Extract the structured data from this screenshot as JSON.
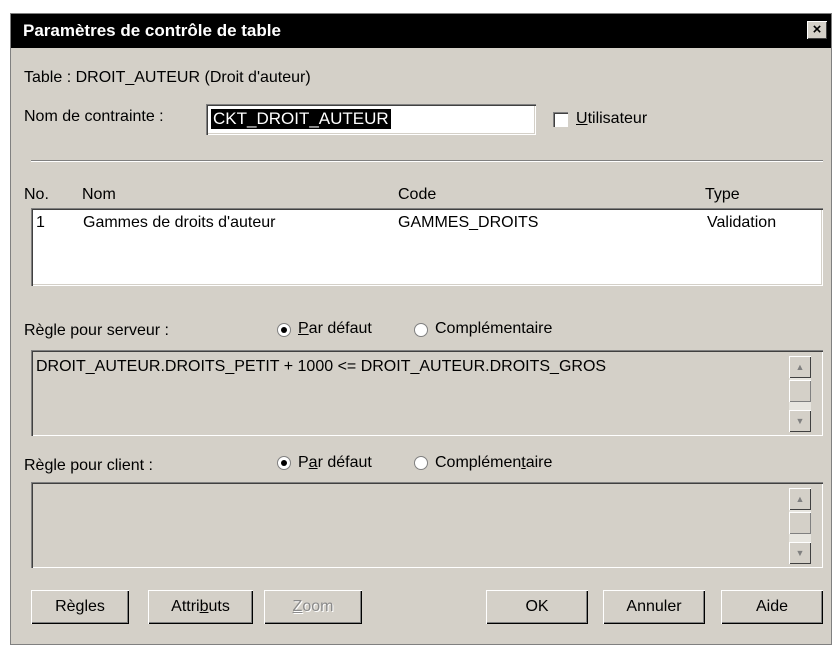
{
  "window": {
    "title": "Paramètres de contrôle de table",
    "close_label": "×"
  },
  "table_info": "Table :  DROIT_AUTEUR  (Droit d'auteur)",
  "constraint": {
    "label": "Nom de contrainte :",
    "value": "CKT_DROIT_AUTEUR",
    "user_checkbox_label": "Utilisateur",
    "user_checked": false
  },
  "list": {
    "headers": [
      "No.",
      "Nom",
      "Code",
      "Type"
    ],
    "rows": [
      {
        "no": "1",
        "nom": "Gammes de droits d'auteur",
        "code": "GAMMES_DROITS",
        "type": "Validation"
      }
    ]
  },
  "server_rule": {
    "label": "Règle pour serveur :",
    "options": [
      "Par défaut",
      "Complémentaire"
    ],
    "selected": "Par défaut",
    "text": "DROIT_AUTEUR.DROITS_PETIT + 1000 <= DROIT_AUTEUR.DROITS_GROS"
  },
  "client_rule": {
    "label": "Règle pour client :",
    "options": [
      "Par défaut",
      "Complémentaire"
    ],
    "selected": "Par défaut",
    "text": ""
  },
  "buttons": {
    "rules": "Règles",
    "attributes": "Attributs",
    "zoom": "Zoom",
    "ok": "OK",
    "cancel": "Annuler",
    "help": "Aide"
  }
}
